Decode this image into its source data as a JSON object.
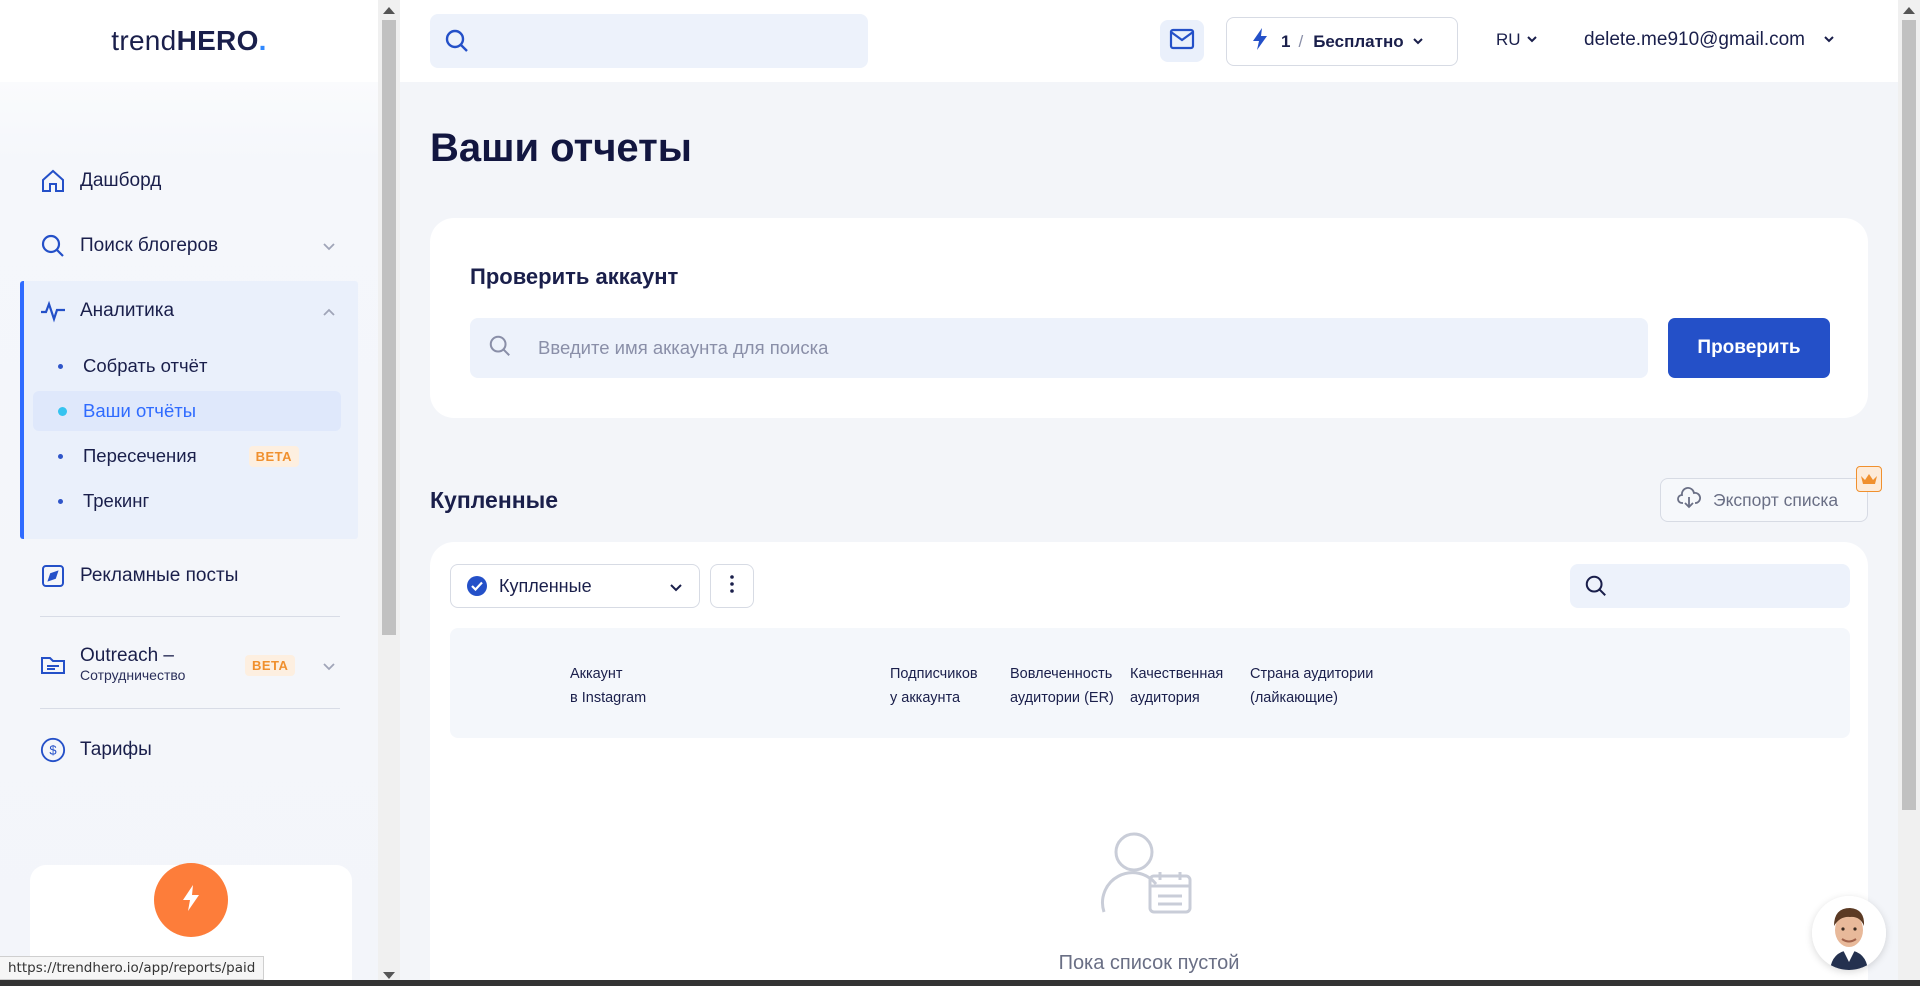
{
  "brand": {
    "logo_prefix": "trend",
    "logo_bold": "HERO",
    "logo_dot": "."
  },
  "sidebar": {
    "dashboard": "Дашборд",
    "search_bloggers": "Поиск блогеров",
    "analytics": "Аналитика",
    "analytics_items": [
      {
        "label": "Собрать отчёт"
      },
      {
        "label": "Ваши отчёты",
        "active": true
      },
      {
        "label": "Пересечения",
        "badge": "BETA"
      },
      {
        "label": "Трекинг"
      }
    ],
    "ad_posts": "Рекламные посты",
    "outreach": "Outreach –",
    "outreach_sub": "Сотрудничество",
    "outreach_badge": "BETA",
    "tariffs": "Тарифы"
  },
  "topbar": {
    "search_placeholder": "",
    "plan_count": "1",
    "plan_sep": "/",
    "plan_name": "Бесплатно",
    "lang": "RU",
    "user_email": "delete.me910@gmail.com"
  },
  "main": {
    "title": "Ваши отчеты",
    "check": {
      "title": "Проверить аккаунт",
      "placeholder": "Введите имя аккаунта для поиска",
      "button": "Проверить"
    },
    "purchased": {
      "title": "Купленные",
      "export": "Экспорт списка",
      "filter": "Купленные",
      "search_placeholder": "",
      "columns": [
        "Аккаунт\nв Instagram",
        "Подписчиков\nу аккаунта",
        "Вовлеченность\nаудитории (ER)",
        "Качественная\nаудитория",
        "Страна аудитории\n(лайкающие)"
      ],
      "empty": "Пока список пустой"
    }
  },
  "status_url": "https://trendhero.io/app/reports/paid",
  "colors": {
    "accent": "#2450c8",
    "orange": "#fd7d3a",
    "bg": "#f3f5f9"
  }
}
